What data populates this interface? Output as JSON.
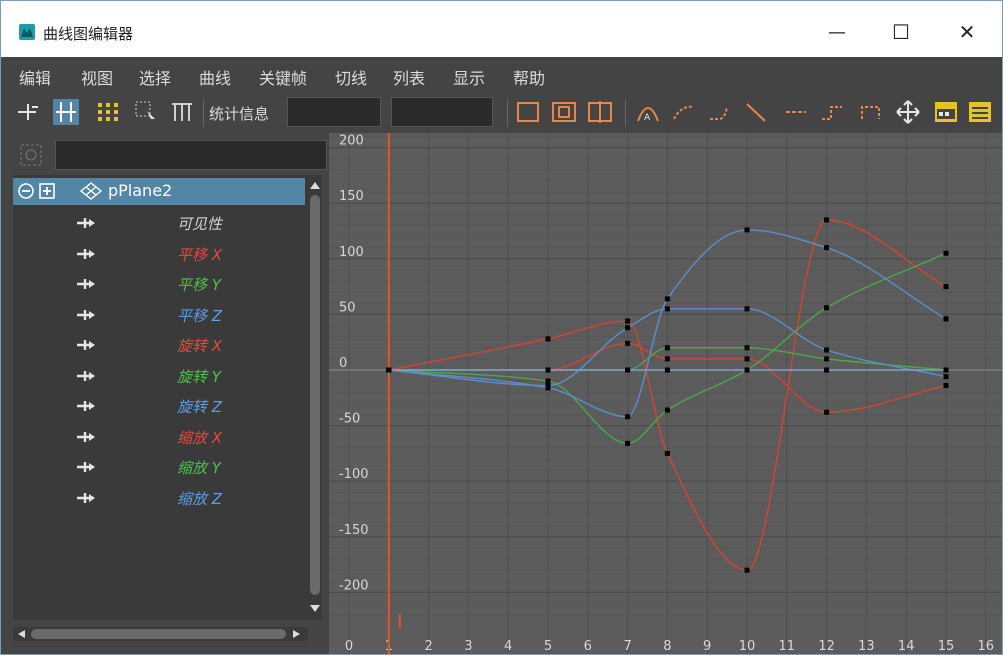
{
  "window": {
    "title": "曲线图编辑器",
    "minimize_glyph": "—",
    "maximize_glyph": "☐",
    "close_glyph": "✕"
  },
  "menu": [
    "编辑",
    "视图",
    "选择",
    "曲线",
    "关键帧",
    "切线",
    "列表",
    "显示",
    "帮助"
  ],
  "toolbar": {
    "stats_label": "统计信息",
    "stat_field_1": "",
    "stat_field_2": ""
  },
  "outliner": {
    "filter_value": "",
    "object_name": "pPlane2",
    "attributes": [
      {
        "label": "可见性",
        "color": "#d4d4d4"
      },
      {
        "label": "平移 X",
        "color": "#e8493b"
      },
      {
        "label": "平移 Y",
        "color": "#4cc24c"
      },
      {
        "label": "平移 Z",
        "color": "#5b9fe6"
      },
      {
        "label": "旋转 X",
        "color": "#e8493b"
      },
      {
        "label": "旋转 Y",
        "color": "#4cc24c"
      },
      {
        "label": "旋转 Z",
        "color": "#5b9fe6"
      },
      {
        "label": "缩放 X",
        "color": "#e8493b"
      },
      {
        "label": "缩放 Y",
        "color": "#4cc24c"
      },
      {
        "label": "缩放 Z",
        "color": "#5b9fe6"
      }
    ]
  },
  "chart_data": {
    "type": "line",
    "xlim": [
      0,
      16
    ],
    "ylim": [
      -220,
      210
    ],
    "x_ticks": [
      0,
      1,
      2,
      3,
      4,
      5,
      6,
      7,
      8,
      9,
      10,
      11,
      12,
      13,
      14,
      15,
      16
    ],
    "y_ticks": [
      200,
      150,
      100,
      50,
      0,
      -50,
      -100,
      -150,
      -200
    ],
    "current_frame": 1,
    "grid": true,
    "series": [
      {
        "color": "#d8432f",
        "points": [
          [
            1,
            0
          ],
          [
            5,
            28
          ],
          [
            7,
            44
          ],
          [
            8,
            -75
          ],
          [
            10,
            -180
          ],
          [
            12,
            135
          ],
          [
            15,
            75
          ]
        ]
      },
      {
        "color": "#d8432f",
        "points": [
          [
            1,
            0
          ],
          [
            5,
            0
          ],
          [
            7,
            24
          ],
          [
            8,
            10
          ],
          [
            10,
            10
          ],
          [
            12,
            -38
          ],
          [
            15,
            -14
          ]
        ]
      },
      {
        "color": "#4aa84a",
        "points": [
          [
            1,
            0
          ],
          [
            5,
            -10
          ],
          [
            7,
            -66
          ],
          [
            8,
            -36
          ],
          [
            10,
            0
          ],
          [
            12,
            56
          ],
          [
            15,
            105
          ]
        ]
      },
      {
        "color": "#4aa84a",
        "points": [
          [
            1,
            0
          ],
          [
            5,
            0
          ],
          [
            7,
            0
          ],
          [
            8,
            20
          ],
          [
            10,
            20
          ],
          [
            12,
            10
          ],
          [
            15,
            0
          ]
        ]
      },
      {
        "color": "#5a8fcc",
        "points": [
          [
            1,
            0
          ],
          [
            5,
            -16
          ],
          [
            7,
            -42
          ],
          [
            8,
            64
          ],
          [
            10,
            126
          ],
          [
            12,
            110
          ],
          [
            15,
            46
          ]
        ]
      },
      {
        "color": "#5a8fcc",
        "points": [
          [
            1,
            0
          ],
          [
            5,
            -14
          ],
          [
            7,
            38
          ],
          [
            8,
            55
          ],
          [
            10,
            55
          ],
          [
            12,
            18
          ],
          [
            15,
            -6
          ]
        ]
      },
      {
        "color": "#7fa0d6",
        "points": [
          [
            1,
            0
          ],
          [
            5,
            0
          ],
          [
            7,
            0
          ],
          [
            8,
            0
          ],
          [
            10,
            0
          ],
          [
            12,
            0
          ],
          [
            15,
            0
          ]
        ]
      }
    ]
  }
}
